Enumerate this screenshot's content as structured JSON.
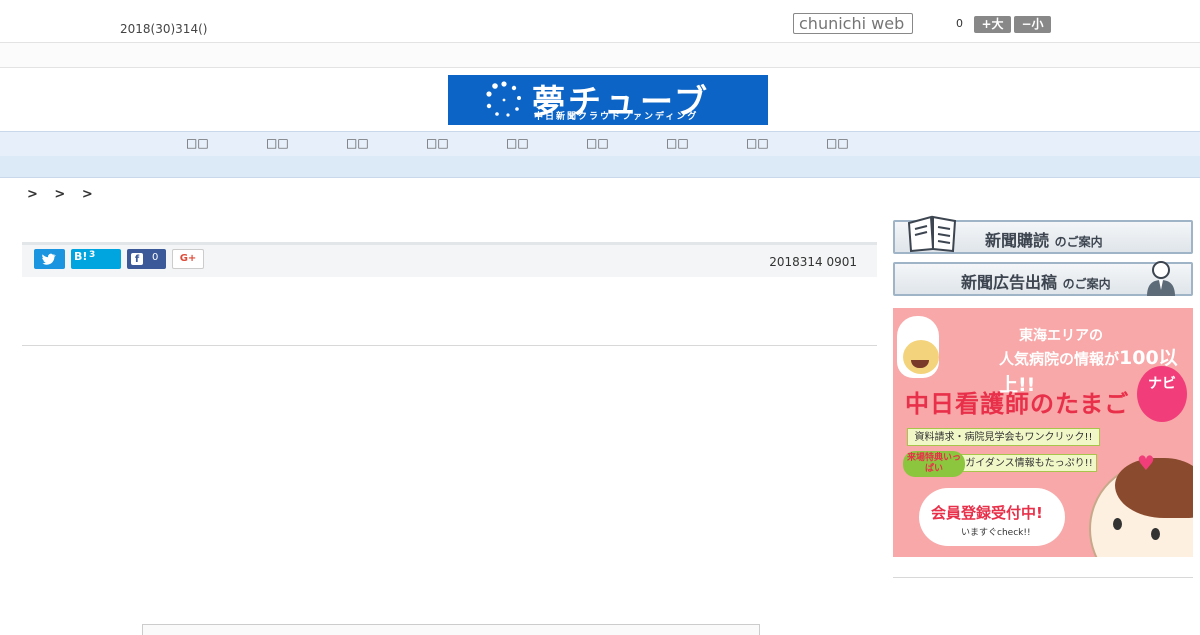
{
  "header": {
    "date": "2018(30)314()",
    "search_placeholder": "chunichi web",
    "count": "0",
    "font_large": "+大",
    "font_small": "−小"
  },
  "logo": {
    "title": "夢チューブ",
    "subtitle": "中日新聞クラウドファンディング",
    "background_color": "#0c64c6"
  },
  "nav": {
    "items": [
      "□□",
      "□□",
      "□□",
      "□□",
      "□□",
      "□□",
      "□□",
      "□□",
      "□□"
    ]
  },
  "breadcrumb": "> > >",
  "share": {
    "twitter_icon": "twitter-icon",
    "hatena_mark": "B!",
    "hatena_count": "3",
    "facebook_mark": "f",
    "facebook_count": "0",
    "googleplus_label": "G+",
    "published": "2018314 0901"
  },
  "sidebar": {
    "banner_subscribe_main": "新聞購読",
    "banner_subscribe_small": "のご案内",
    "banner_ad_main": "新聞広告出稿",
    "banner_ad_small": "のご案内",
    "ad": {
      "line1": "東海エリアの",
      "line2_pre": "人気病院の情報が",
      "line2_num": "100以上!!",
      "title": "中日看護師のたまご",
      "navi": "ナビ",
      "feature1": "資料請求・病院見学会もワンクリック!!",
      "badge": "来場特典いっぱい",
      "feature2": "ガイダンス情報もたっぷり!!",
      "cta": "会員登録受付中!",
      "cta_sub": "いますぐcheck!!",
      "background_color": "#f8a8a8"
    }
  }
}
